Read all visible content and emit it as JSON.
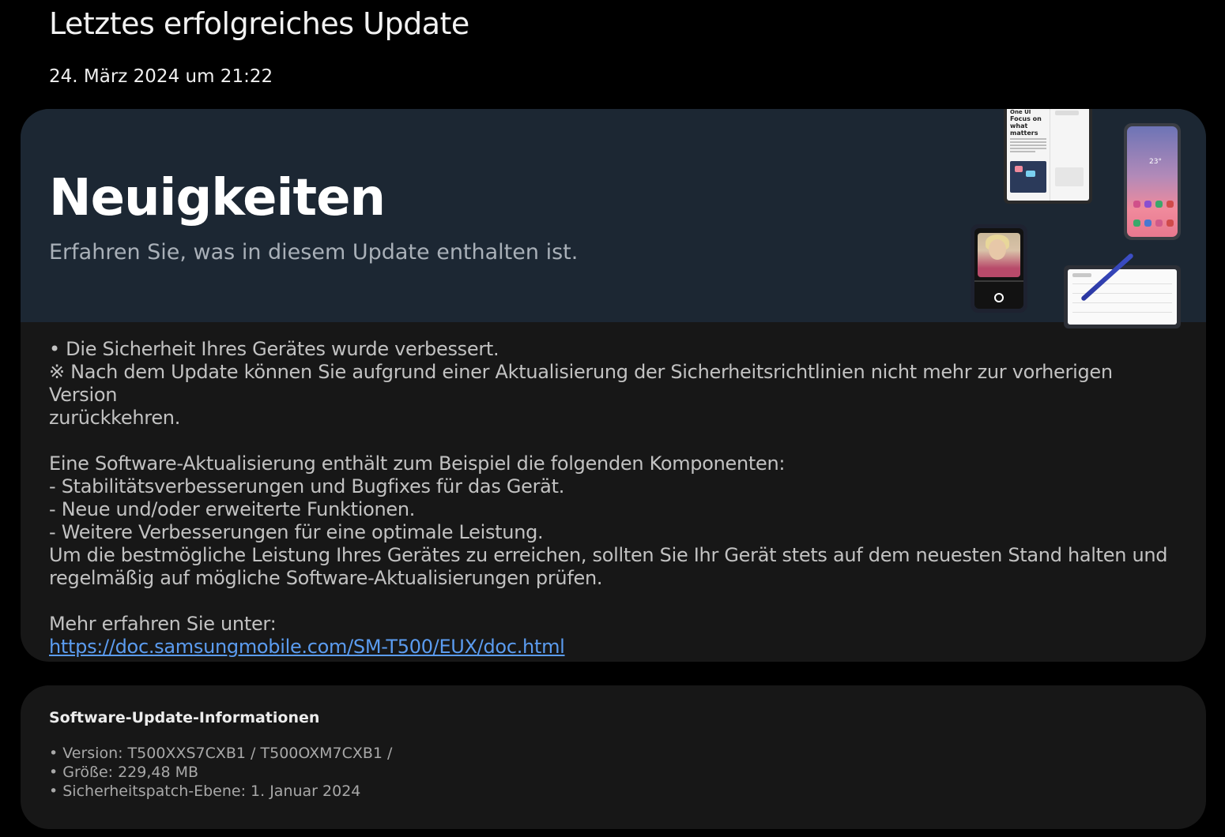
{
  "header": {
    "title": "Letztes erfolgreiches Update",
    "date": "24. März 2024 um 21:22"
  },
  "news": {
    "heading": "Neuigkeiten",
    "subheading": "Erfahren Sie, was in diesem Update enthalten ist.",
    "illustration": {
      "foldable_text_brand": "One UI",
      "foldable_text_headline": "Focus on what matters",
      "phone_temperature": "23°"
    },
    "body": {
      "line1": "• Die Sicherheit Ihres Gerätes wurde verbessert.",
      "line2": "※ Nach dem Update können Sie aufgrund einer Aktualisierung der Sicherheitsrichtlinien nicht mehr zur vorherigen Version",
      "line3": "zurückkehren.",
      "line4": "Eine Software-Aktualisierung enthält zum Beispiel die folgenden Komponenten:",
      "line5": " - Stabilitätsverbesserungen und Bugfixes für das Gerät.",
      "line6": " - Neue und/oder erweiterte Funktionen.",
      "line7": " - Weitere Verbesserungen für eine optimale Leistung.",
      "line8": "Um die bestmögliche Leistung Ihres Gerätes zu erreichen, sollten Sie Ihr Gerät stets auf dem neuesten Stand halten und",
      "line9": "regelmäßig auf mögliche Software-Aktualisierungen prüfen.",
      "line10": "Mehr erfahren Sie unter:",
      "link": "https://doc.samsungmobile.com/SM-T500/EUX/doc.html"
    }
  },
  "info": {
    "title": "Software-Update-Informationen",
    "version": "• Version: T500XXS7CXB1 / T500OXM7CXB1 /",
    "size": "• Größe: 229,48 MB",
    "patch": "• Sicherheitspatch-Ebene: 1. Januar 2024"
  },
  "colors": {
    "background": "#000000",
    "card": "#171717",
    "banner": "#1c2733",
    "link": "#5b9cf0"
  }
}
